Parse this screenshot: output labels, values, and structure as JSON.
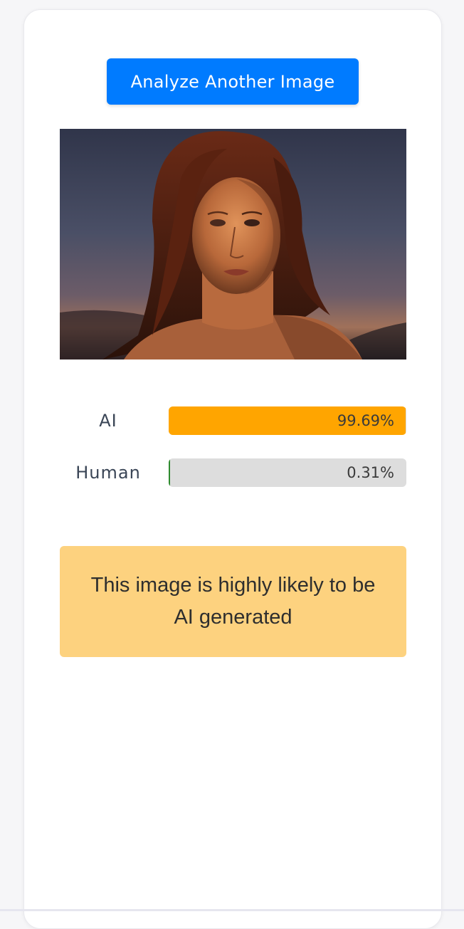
{
  "actions": {
    "analyze_another_label": "Analyze Another Image"
  },
  "results": [
    {
      "label": "AI",
      "value_text": "99.69%",
      "value": 99.69,
      "color": "#ffa500"
    },
    {
      "label": "Human",
      "value_text": "0.31%",
      "value": 0.31,
      "color": "#2e8b2e"
    }
  ],
  "verdict": {
    "text": "This image is highly likely to be AI generated",
    "background": "#fdd27f"
  },
  "colors": {
    "accent": "#007bff",
    "track": "#dddddd"
  }
}
